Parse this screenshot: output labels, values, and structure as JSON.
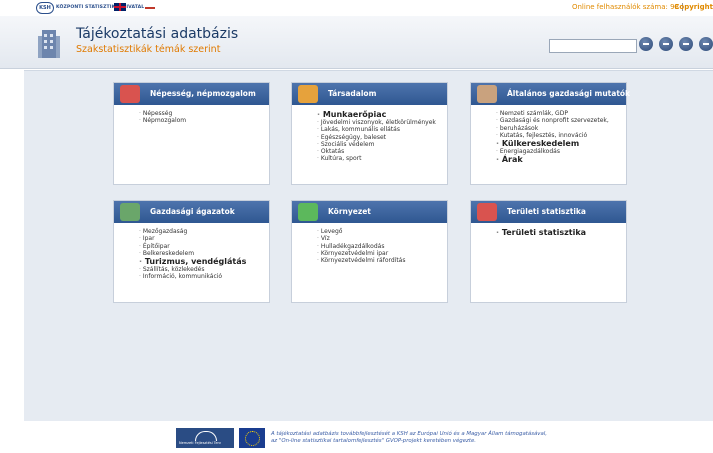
{
  "top": {
    "ksh_abbr": "KSH",
    "ksh_name": "KÖZPONTI STATISZTIKAI HIVATAL",
    "online_users": "Online felhasználók száma: 93",
    "separator": "|",
    "copyright": "Copyright"
  },
  "header": {
    "title": "Tájékoztatási adatbázis",
    "subtitle": "Szakstatisztikák témák szerint",
    "search_value": ""
  },
  "cards": [
    {
      "title": "Népesség, népmozgalom",
      "items": [
        {
          "label": "Népesség"
        },
        {
          "label": "Népmozgalom"
        }
      ]
    },
    {
      "title": "Társadalom",
      "items": [
        {
          "label": "Munkaerőpiac"
        },
        {
          "label": "Jövedelmi viszonyok, életkörülmények"
        },
        {
          "label": "Lakás, kommunális ellátás"
        },
        {
          "label": "Egészségügy, baleset"
        },
        {
          "label": "Szociális védelem"
        },
        {
          "label": "Oktatás"
        },
        {
          "label": "Kultúra, sport"
        }
      ]
    },
    {
      "title": "Általános gazdasági mutatók",
      "items": [
        {
          "label": "Nemzeti számlák, GDP"
        },
        {
          "label": "Gazdasági és nonprofit szervezetek,"
        },
        {
          "label": "beruházások"
        },
        {
          "label": "Kutatás, fejlesztés, innováció"
        },
        {
          "label": "Külkereskedelem"
        },
        {
          "label": "Energiagazdálkodás"
        },
        {
          "label": "Árak"
        }
      ]
    },
    {
      "title": "Gazdasági ágazatok",
      "items": [
        {
          "label": "Mezőgazdaság"
        },
        {
          "label": "Ipar"
        },
        {
          "label": "Építőipar"
        },
        {
          "label": "Belkereskedelem"
        },
        {
          "label": "Turizmus, vendéglátás"
        },
        {
          "label": "Szállítás, közlekedés"
        },
        {
          "label": "Információ, kommunikáció"
        }
      ]
    },
    {
      "title": "Környezet",
      "items": [
        {
          "label": "Levegő"
        },
        {
          "label": "Víz"
        },
        {
          "label": "Hulladékgazdálkodás"
        },
        {
          "label": "Környezetvédelmi ipar"
        },
        {
          "label": "Környezetvédelmi ráfordítás"
        }
      ]
    },
    {
      "title": "Területi statisztika",
      "items": [
        {
          "label": "Területi statisztika"
        }
      ]
    }
  ],
  "footer": {
    "logo_text": "Nemzeti Fejlesztési Terv",
    "line1": "A tájékoztatási adatbázis továbbfejlesztését a KSH az Európai Unió és a Magyar Állam támogatásával,",
    "line2": "az \"On-line statisztikai tartalomfejlesztés\" GVOP-projekt keretében végezte."
  },
  "colors": {
    "accent_orange": "#e07a00",
    "header_blue": "#2f5791",
    "panel_bg": "#e6ebf2"
  }
}
